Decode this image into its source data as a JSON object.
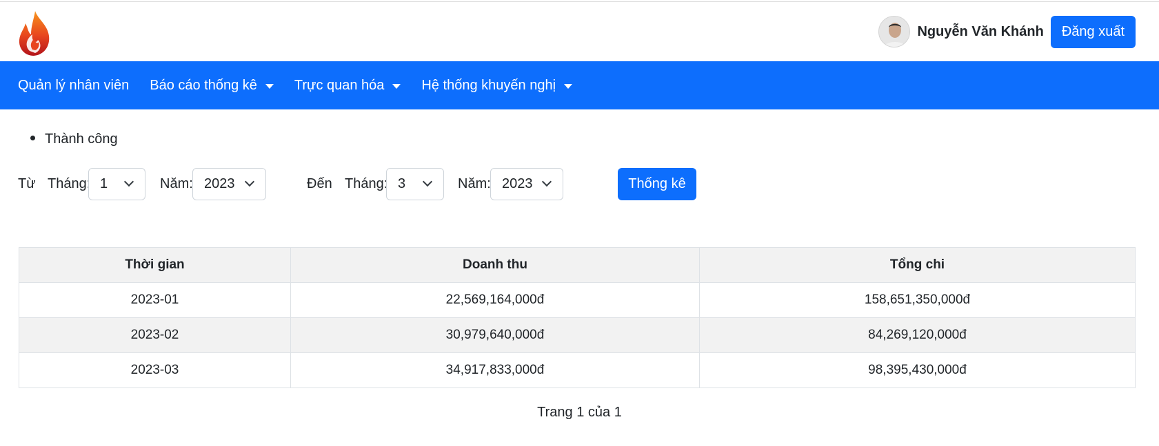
{
  "header": {
    "username": "Nguyễn Văn Khánh",
    "logout_label": "Đăng xuất"
  },
  "nav": {
    "items": [
      {
        "label": "Quản lý nhân viên",
        "dropdown": false
      },
      {
        "label": "Báo cáo thống kê",
        "dropdown": true
      },
      {
        "label": "Trực quan hóa",
        "dropdown": true
      },
      {
        "label": "Hệ thống khuyến nghị",
        "dropdown": true
      }
    ]
  },
  "status": {
    "messages": [
      "Thành công"
    ]
  },
  "filters": {
    "from_label": "Từ",
    "to_label": "Đến",
    "month_label": "Tháng:",
    "year_label": "Năm:",
    "from_month": "1",
    "from_year": "2023",
    "to_month": "3",
    "to_year": "2023",
    "submit_label": "Thống kê"
  },
  "table": {
    "headers": [
      "Thời gian",
      "Doanh thu",
      "Tổng chi"
    ],
    "rows": [
      [
        "2023-01",
        "22,569,164,000đ",
        "158,651,350,000đ"
      ],
      [
        "2023-02",
        "30,979,640,000đ",
        "84,269,120,000đ"
      ],
      [
        "2023-03",
        "34,917,833,000đ",
        "98,395,430,000đ"
      ]
    ]
  },
  "pagination": {
    "text": "Trang 1 của 1"
  },
  "colors": {
    "primary": "#0d6efd",
    "stripe": "#f2f2f2"
  }
}
